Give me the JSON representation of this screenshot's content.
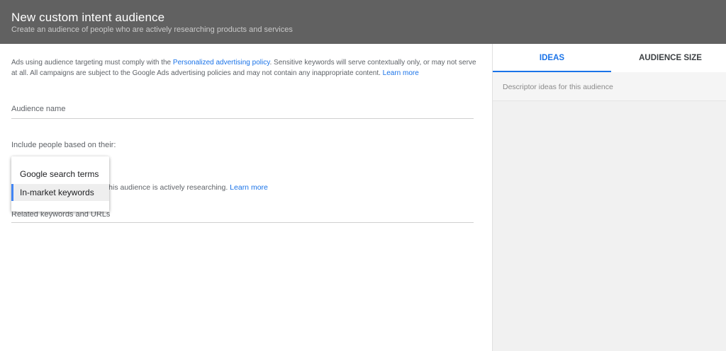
{
  "header": {
    "title": "New custom intent audience",
    "subtitle": "Create an audience of people who are actively researching products and services"
  },
  "policy": {
    "text_before": "Ads using audience targeting must comply with the ",
    "link_text": "Personalized advertising policy",
    "text_after": ". Sensitive keywords will serve contextually only, or may not serve at all. All campaigns are subject to the Google Ads advertising policies and may not contain any inappropriate content. ",
    "learn_more": "Learn more"
  },
  "form": {
    "audience_name_label": "Audience name",
    "include_label": "Include people based on their:",
    "helper_text": "ted to products and services this audience is actively researching. ",
    "helper_link": "Learn more",
    "related_keywords_label": "Related keywords and URLs"
  },
  "dropdown": {
    "options": [
      "Google search terms",
      "In-market keywords"
    ],
    "selected": "In-market keywords"
  },
  "sidebar": {
    "tabs": [
      "IDEAS",
      "AUDIENCE SIZE"
    ],
    "active_tab": "IDEAS",
    "ideas_placeholder": "Descriptor ideas for this audience"
  },
  "colors": {
    "header_bg": "#616161",
    "accent": "#1a73e8",
    "side_bg": "#f1f1f1",
    "selection_bar": "#4285f4"
  }
}
